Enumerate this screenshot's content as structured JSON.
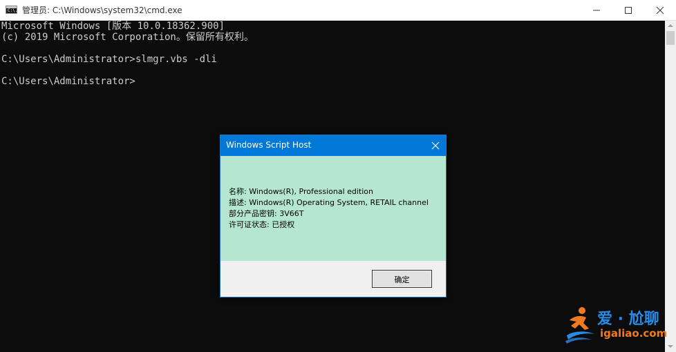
{
  "window": {
    "title": "管理员: C:\\Windows\\system32\\cmd.exe",
    "icon": "cmd-icon",
    "icon_text": "C:\\."
  },
  "console": {
    "lines": [
      "Microsoft Windows [版本 10.0.18362.900]",
      "(c) 2019 Microsoft Corporation。保留所有权利。",
      "",
      "C:\\Users\\Administrator>slmgr.vbs -dli",
      "",
      "C:\\Users\\Administrator>"
    ]
  },
  "dialog": {
    "title": "Windows Script Host",
    "lines": [
      "名称: Windows(R), Professional edition",
      "描述: Windows(R) Operating System, RETAIL channel",
      "部分产品密钥: 3V66T",
      "许可证状态: 已授权"
    ],
    "ok_label": "确定",
    "body_color": "#b4e6d2",
    "accent_color": "#0078d7"
  },
  "watermark": {
    "brand": "爱 · 尬聊",
    "url": "igaliao.com"
  }
}
